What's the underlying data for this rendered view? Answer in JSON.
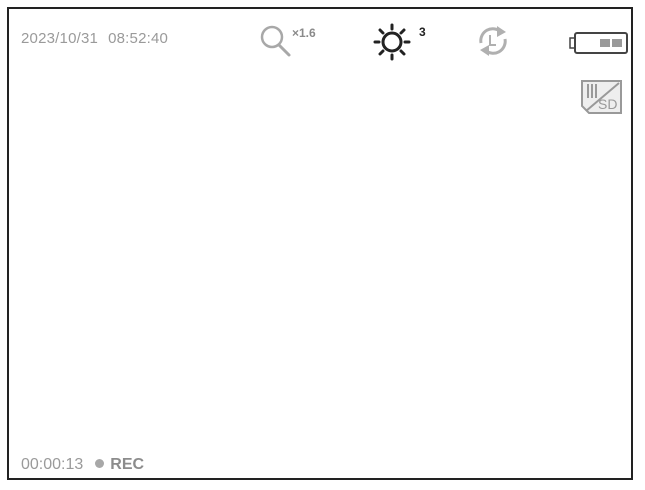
{
  "status_bar": {
    "date": "2023/10/31",
    "time": "08:52:40",
    "zoom_label": "×1.6",
    "brightness_level": "3"
  },
  "icons": {
    "zoom": "magnifier-icon",
    "brightness": "sun-icon",
    "rotate": "rotate-icon",
    "battery": "battery-icon",
    "sd_card": "sd-card-icon"
  },
  "battery": {
    "level": 0.5
  },
  "recording": {
    "elapsed": "00:00:13",
    "label": "REC"
  },
  "colors": {
    "frame": "#222222",
    "status_text": "#9a9a9a",
    "icon_gray": "#a8a8a8",
    "icon_dark": "#222222"
  }
}
